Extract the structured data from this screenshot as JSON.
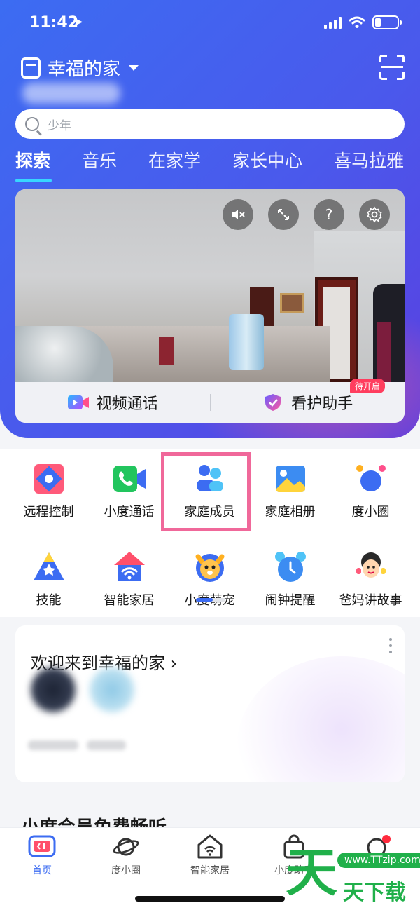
{
  "status_bar": {
    "time": "11:42",
    "location_arrow": "location-arrow-icon"
  },
  "header": {
    "home_name": "幸福的家",
    "search_placeholder": "少年"
  },
  "tabs": [
    {
      "label": "探索",
      "active": true
    },
    {
      "label": "音乐",
      "active": false
    },
    {
      "label": "在家学",
      "active": false
    },
    {
      "label": "家长中心",
      "active": false
    },
    {
      "label": "喜马拉雅",
      "active": false
    }
  ],
  "video": {
    "controls": [
      "mute-icon",
      "fullscreen-icon",
      "help-icon",
      "settings-icon"
    ],
    "help_glyph": "?",
    "actions": {
      "video_call": "视频通话",
      "care_assistant": "看护助手",
      "care_badge": "待开启"
    }
  },
  "shortcuts": [
    {
      "label": "远程控制",
      "icon": "remote-control-icon"
    },
    {
      "label": "小度通话",
      "icon": "xiaodu-call-icon"
    },
    {
      "label": "家庭成员",
      "icon": "family-members-icon"
    },
    {
      "label": "家庭相册",
      "icon": "family-album-icon"
    },
    {
      "label": "度小圈",
      "icon": "du-circle-icon"
    },
    {
      "label": "技能",
      "icon": "skills-icon"
    },
    {
      "label": "智能家居",
      "icon": "smart-home-icon"
    },
    {
      "label": "小度萌宠",
      "icon": "xiaodu-pet-icon"
    },
    {
      "label": "闹钟提醒",
      "icon": "alarm-icon"
    },
    {
      "label": "爸妈讲故事",
      "icon": "parents-story-icon"
    }
  ],
  "welcome": {
    "title": "欢迎来到幸福的家",
    "chevron": "›"
  },
  "vip_section": {
    "title": "小度会员免费畅听"
  },
  "tabbar": [
    {
      "label": "首页",
      "active": true
    },
    {
      "label": "度小圈",
      "active": false
    },
    {
      "label": "智能家居",
      "active": false
    },
    {
      "label": "小度助手",
      "active": false
    },
    {
      "label": "",
      "active": false
    }
  ],
  "watermark": {
    "char": "天",
    "url": "www.TTzip.com",
    "sub": "天下载"
  },
  "colors": {
    "brand_blue": "#3c6cf2",
    "highlight_pink": "#f0689a",
    "badge_red": "#ff3d5e",
    "tab_indicator": "#37d6ff"
  }
}
